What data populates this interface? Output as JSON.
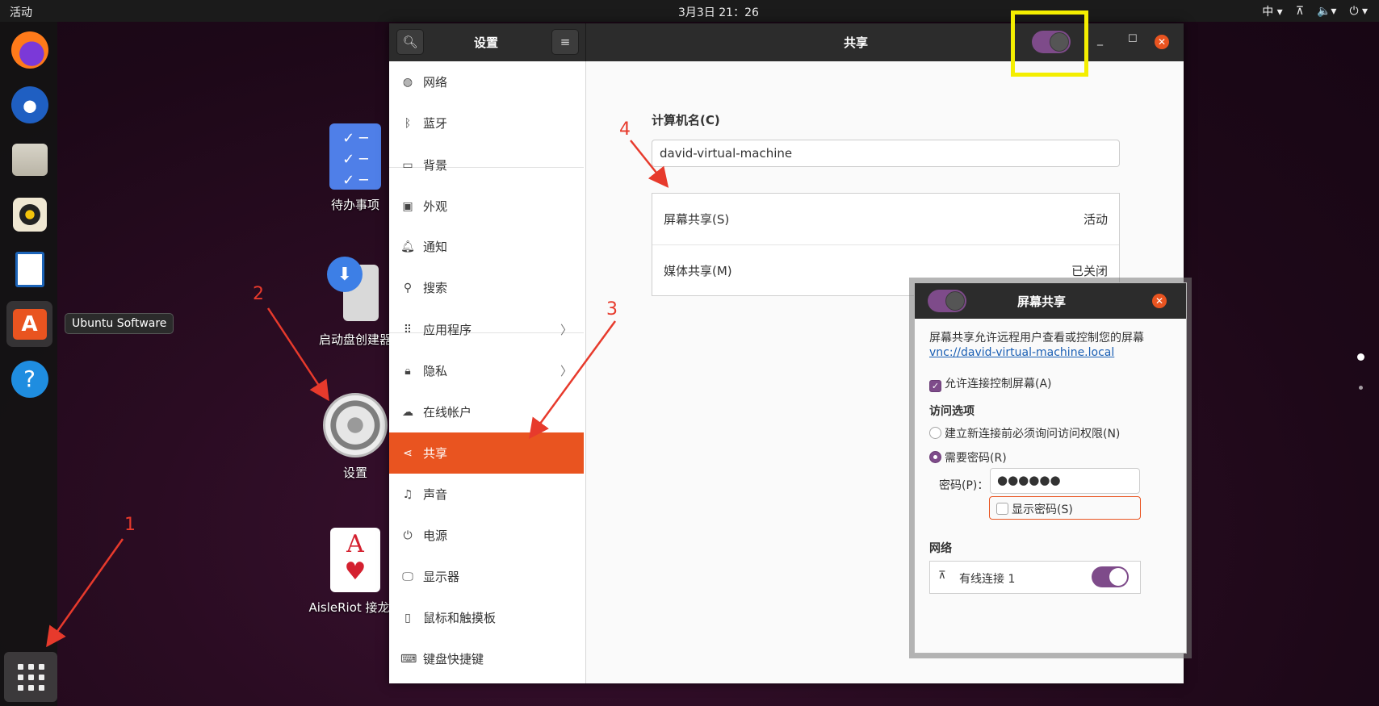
{
  "topbar": {
    "activities": "活动",
    "clock": "3月3日  21：26",
    "input_method": "中 ▾",
    "network": "⊼",
    "volume": "🔈▾",
    "power": "⏻ ▾"
  },
  "dock": {
    "items": [
      "firefox",
      "thunderbird",
      "files",
      "rhythmbox",
      "libreoffice-writer",
      "ubuntu-software",
      "help"
    ],
    "tooltip": "Ubuntu Software"
  },
  "desktop": {
    "icons": [
      {
        "label": "待办事项"
      },
      {
        "label": "启动盘创建器"
      },
      {
        "label": "设置"
      },
      {
        "label": "AisleRiot 接龙游"
      }
    ]
  },
  "annotations": [
    "1",
    "2",
    "3",
    "4"
  ],
  "window": {
    "sidebar_title": "设置",
    "title": "共享",
    "sidebar": [
      {
        "label": "网络",
        "icon": "globe-icon"
      },
      {
        "label": "蓝牙",
        "icon": "bluetooth-icon"
      },
      {
        "label": "背景",
        "icon": "monitor-icon"
      },
      {
        "label": "外观",
        "icon": "appearance-icon"
      },
      {
        "label": "通知",
        "icon": "bell-icon"
      },
      {
        "label": "搜索",
        "icon": "search-icon"
      },
      {
        "label": "应用程序",
        "icon": "grid-icon"
      },
      {
        "label": "隐私",
        "icon": "lock-icon"
      },
      {
        "label": "在线帐户",
        "icon": "cloud-icon"
      },
      {
        "label": "共享",
        "icon": "share-icon"
      },
      {
        "label": "声音",
        "icon": "music-icon"
      },
      {
        "label": "电源",
        "icon": "power-icon"
      },
      {
        "label": "显示器",
        "icon": "display-icon"
      },
      {
        "label": "鼠标和触摸板",
        "icon": "mouse-icon"
      },
      {
        "label": "键盘快捷键",
        "icon": "keyboard-icon"
      }
    ],
    "computer_name_label": "计算机名(C)",
    "computer_name_value": "david-virtual-machine",
    "rows": [
      {
        "label": "屏幕共享(S)",
        "status": "活动"
      },
      {
        "label": "媒体共享(M)",
        "status": "已关闭"
      }
    ]
  },
  "dialog": {
    "title": "屏幕共享",
    "description": "屏幕共享允许远程用户查看或控制您的屏幕",
    "vnc_link": "vnc://david-virtual-machine.local",
    "allow_control": "允许连接控制屏幕(A)",
    "access_heading": "访问选项",
    "option_ask": "建立新连接前必须询问访问权限(N)",
    "option_password": "需要密码(R)",
    "password_label": "密码(P)：",
    "password_value": "●●●●●●",
    "show_password": "显示密码(S)",
    "network_heading": "网络",
    "connection": "有线连接 1"
  },
  "colors": {
    "accent": "#e95420",
    "switch_on": "#7e4b8a",
    "highlight": "#f4ee00",
    "annotation": "#e73a2c"
  }
}
